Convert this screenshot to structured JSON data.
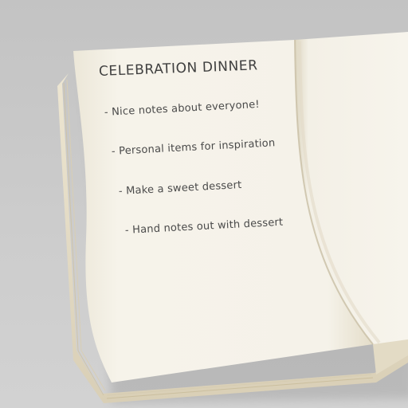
{
  "notebook": {
    "title": "CELEBRATION DINNER",
    "notes": [
      "- Nice notes about everyone!",
      "- Personal items for inspiration",
      "- Make a sweet dessert",
      "- Hand notes out with dessert"
    ]
  },
  "colors": {
    "background": "#c9c9c9",
    "page": "#f6f3ea",
    "page_edge": "#e7e1cf",
    "ink": "#4a4a4a"
  }
}
